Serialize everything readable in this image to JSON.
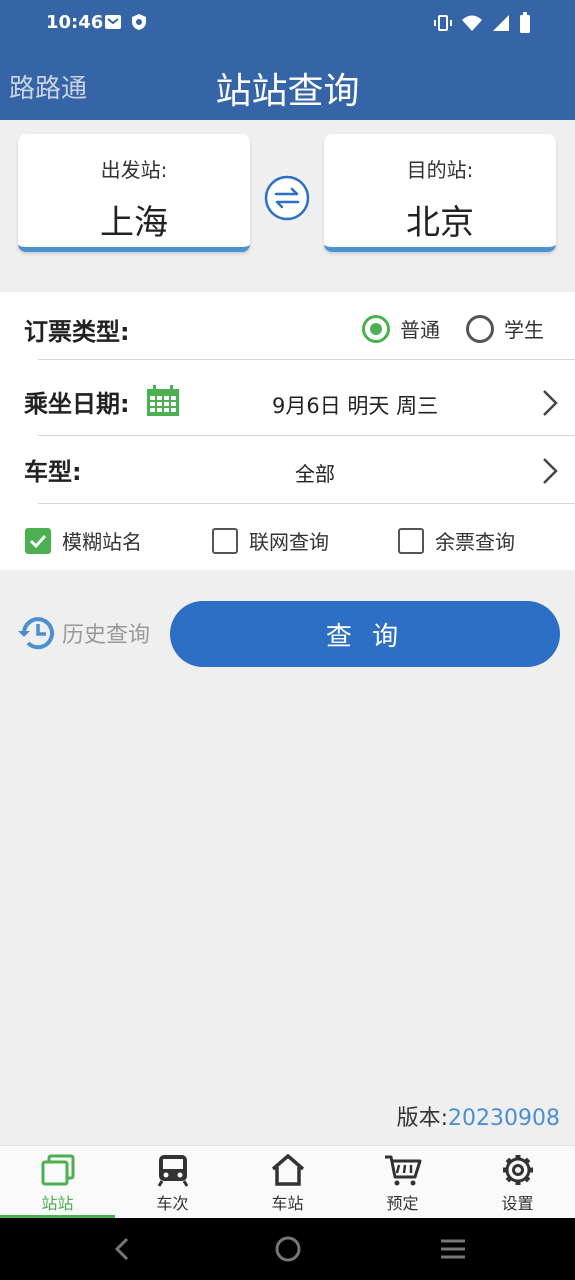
{
  "status_bar": {
    "time": "10:46"
  },
  "app_bar": {
    "brand": "路路通",
    "title": "站站查询"
  },
  "stations": {
    "from_label": "出发站:",
    "from_value": "上海",
    "to_label": "目的站:",
    "to_value": "北京"
  },
  "ticket_type": {
    "label": "订票类型:",
    "options": [
      "普通",
      "学生"
    ],
    "selected": "普通"
  },
  "date": {
    "label": "乘坐日期:",
    "value": "9月6日 明天 周三"
  },
  "train_type": {
    "label": "车型:",
    "value": "全部"
  },
  "checkboxes": [
    {
      "label": "模糊站名",
      "checked": true
    },
    {
      "label": "联网查询",
      "checked": false
    },
    {
      "label": "余票查询",
      "checked": false
    }
  ],
  "history_label": "历史查询",
  "query_label": "查 询",
  "version": {
    "label": "版本:",
    "value": "20230908"
  },
  "tabs": [
    {
      "label": "站站",
      "icon": "station-station-icon",
      "active": true
    },
    {
      "label": "车次",
      "icon": "train-icon",
      "active": false
    },
    {
      "label": "车站",
      "icon": "home-icon",
      "active": false
    },
    {
      "label": "预定",
      "icon": "cart-icon",
      "active": false
    },
    {
      "label": "设置",
      "icon": "gear-icon",
      "active": false
    }
  ],
  "colors": {
    "primary": "#3565a6",
    "accent_green": "#4caf50",
    "button_blue": "#2d6fc4"
  }
}
